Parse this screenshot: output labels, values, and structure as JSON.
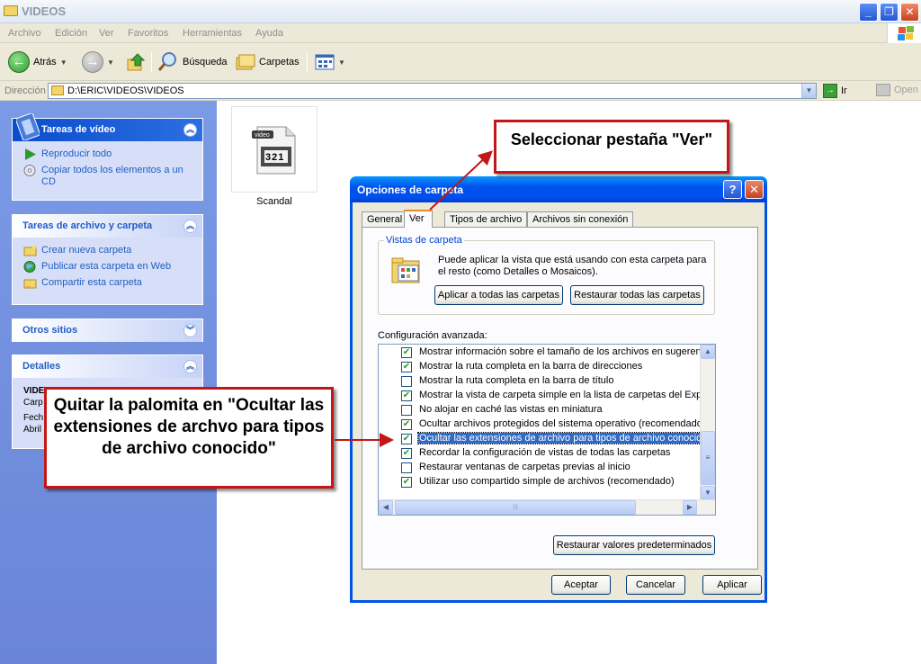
{
  "window": {
    "title": "VIDEOS"
  },
  "menu": [
    "Archivo",
    "Edición",
    "Ver",
    "Favoritos",
    "Herramientas",
    "Ayuda"
  ],
  "toolbar": {
    "back": "Atrás",
    "search": "Búsqueda",
    "folders": "Carpetas"
  },
  "address": {
    "label": "Dirección",
    "value": "D:\\ERIC\\VIDEOS\\VIDEOS",
    "go": "Ir",
    "open": "Open"
  },
  "sidebar": {
    "video_tasks": {
      "title": "Tareas de vídeo",
      "items": [
        "Reproducir todo",
        "Copiar todos los elementos a un CD"
      ]
    },
    "file_tasks": {
      "title": "Tareas de archivo y carpeta",
      "items": [
        "Crear nueva carpeta",
        "Publicar esta carpeta en Web",
        "Compartir esta carpeta"
      ]
    },
    "other_places": {
      "title": "Otros sitios"
    },
    "details": {
      "title": "Detalles",
      "lines": [
        "VIDEO",
        "Carp",
        "Fech",
        "Abril"
      ]
    }
  },
  "file": {
    "name": "Scandal",
    "icon_label": "video",
    "icon_number": "321"
  },
  "dialog": {
    "title": "Opciones de carpeta",
    "help": "?",
    "tabs": [
      "General",
      "Ver",
      "Tipos de archivo",
      "Archivos sin conexión"
    ],
    "folder_views": {
      "label": "Vistas de carpeta",
      "text": "Puede aplicar la vista que está usando con esta carpeta para el resto (como Detalles o Mosaicos).",
      "apply_all": "Aplicar a todas las carpetas",
      "reset_all": "Restaurar todas las carpetas"
    },
    "advanced_label": "Configuración avanzada:",
    "settings": [
      {
        "label": "Mostrar información sobre el tamaño de los archivos en sugerencias",
        "checked": true
      },
      {
        "label": "Mostrar la ruta completa en la barra de direcciones",
        "checked": true
      },
      {
        "label": "Mostrar la ruta completa en la barra de título",
        "checked": false
      },
      {
        "label": "Mostrar la vista de carpeta simple en la lista de carpetas del Explorador",
        "checked": true
      },
      {
        "label": "No alojar en caché las vistas en miniatura",
        "checked": false
      },
      {
        "label": "Ocultar archivos protegidos del sistema operativo (recomendado)",
        "checked": true
      },
      {
        "label": "Ocultar las extensiones de archivo para tipos de archivo conocidos",
        "checked": true
      },
      {
        "label": "Recordar la configuración de vistas de todas las carpetas",
        "checked": true
      },
      {
        "label": "Restaurar ventanas de carpetas previas al inicio",
        "checked": false
      },
      {
        "label": "Utilizar uso compartido simple de archivos (recomendado)",
        "checked": true
      }
    ],
    "restore_defaults": "Restaurar valores predeterminados",
    "ok": "Aceptar",
    "cancel": "Cancelar",
    "apply": "Aplicar"
  },
  "annotations": {
    "tab_note": "Seleccionar pestaña \"Ver\"",
    "checkbox_note": "Quitar la palomita en \"Ocultar las extensiones de archvo para tipos de archivo conocido\""
  },
  "colors": {
    "annotation_border": "#c41616",
    "xp_blue": "#0054e3",
    "link_blue": "#215dc6"
  }
}
